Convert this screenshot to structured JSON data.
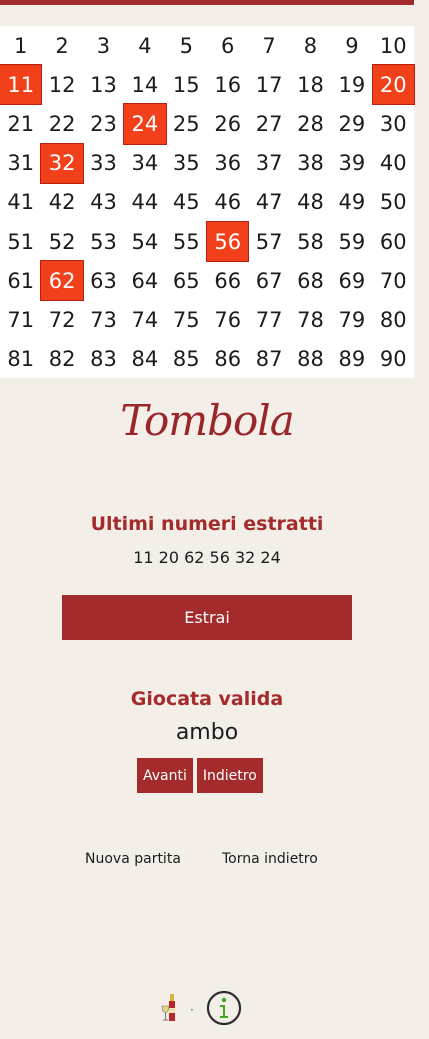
{
  "board": {
    "numbers": [
      1,
      2,
      3,
      4,
      5,
      6,
      7,
      8,
      9,
      10,
      11,
      12,
      13,
      14,
      15,
      16,
      17,
      18,
      19,
      20,
      21,
      22,
      23,
      24,
      25,
      26,
      27,
      28,
      29,
      30,
      31,
      32,
      33,
      34,
      35,
      36,
      37,
      38,
      39,
      40,
      41,
      42,
      43,
      44,
      45,
      46,
      47,
      48,
      49,
      50,
      51,
      52,
      53,
      54,
      55,
      56,
      57,
      58,
      59,
      60,
      61,
      62,
      63,
      64,
      65,
      66,
      67,
      68,
      69,
      70,
      71,
      72,
      73,
      74,
      75,
      76,
      77,
      78,
      79,
      80,
      81,
      82,
      83,
      84,
      85,
      86,
      87,
      88,
      89,
      90
    ],
    "drawn": [
      11,
      20,
      24,
      32,
      56,
      62
    ]
  },
  "logo": {
    "text": "Tombola"
  },
  "last_drawn": {
    "title": "Ultimi numeri estratti",
    "numbers": "11 20 62 56 32 24"
  },
  "draw_button": {
    "label": "Estrai"
  },
  "valid_game": {
    "title": "Giocata valida",
    "value": "ambo",
    "next_label": "Avanti",
    "back_label": "Indietro"
  },
  "links": {
    "new_game": "Nuova partita",
    "go_back": "Torna indietro"
  },
  "footer": {
    "separator": "·",
    "wine_icon": "wine-bottle-glass-icon",
    "info_icon": "info-icon"
  },
  "colors": {
    "accent": "#a42b2b",
    "drawn": "#f2401a",
    "background": "#f3eee8",
    "info_green": "#3fa32b"
  }
}
